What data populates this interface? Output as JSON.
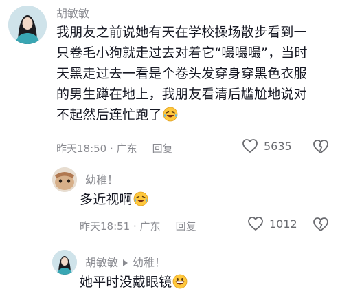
{
  "comments": [
    {
      "username": "胡敏敏",
      "text_lines": [
        "我朋友之前说她有天在学校操场散步看到一",
        "只卷毛小狗就走过去对着它“嘬嘬嘬”，当时",
        "天黑走过去一看是个卷头发穿身穿黑色衣服",
        "的男生蹲在地上，我朋友看清后尴尬地说对",
        "不起然后连忙跑了"
      ],
      "emoji": "laughing-crying-emoji",
      "time": "昨天18:50",
      "location": "广东",
      "reply_label": "回复",
      "likes": "5635"
    },
    {
      "username": "幼稚！",
      "text": "多近视啊",
      "emoji": "laughing-crying-emoji",
      "time": "昨天18:51",
      "location": "广东",
      "reply_label": "回复",
      "likes": "1012"
    },
    {
      "username": "胡敏敏",
      "reply_to": "幼稚！",
      "text": "她平时没戴眼镜",
      "emoji": "grinning-emoji"
    }
  ],
  "separator": " · ",
  "colors": {
    "text": "#161823",
    "muted": "#8a8b91",
    "emoji_yellow": "#ffc83d"
  }
}
